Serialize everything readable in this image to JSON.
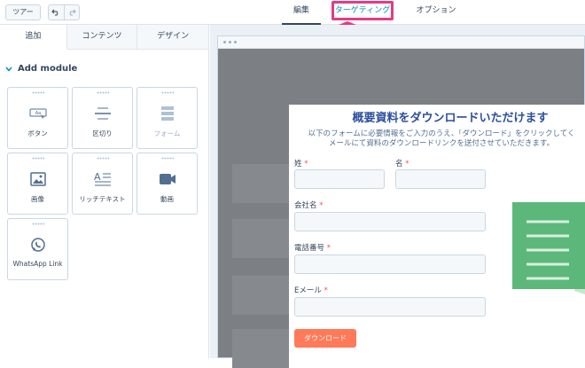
{
  "topbar": {
    "tour_label": "ツアー",
    "tabs": [
      {
        "label": "編集",
        "active": true
      },
      {
        "label": "ターゲティング",
        "highlighted": true
      },
      {
        "label": "オプション"
      }
    ],
    "highlight_color": "#e63a83"
  },
  "sidebar": {
    "tabs": [
      {
        "label": "追加",
        "active": true
      },
      {
        "label": "コンテンツ"
      },
      {
        "label": "デザイン"
      }
    ],
    "section_title": "Add module",
    "modules": [
      {
        "label": "ボタン",
        "icon": "button-icon"
      },
      {
        "label": "区切り",
        "icon": "divider-icon"
      },
      {
        "label": "フォーム",
        "icon": "form-icon",
        "disabled": true
      },
      {
        "label": "画像",
        "icon": "image-icon"
      },
      {
        "label": "リッチテキスト",
        "icon": "rich-text-icon"
      },
      {
        "label": "動画",
        "icon": "video-icon"
      },
      {
        "label": "WhatsApp Link",
        "icon": "whatsapp-icon"
      }
    ]
  },
  "popup": {
    "title": "概要資料をダウンロードいただけます",
    "description": "以下のフォームに必要情報をご入力のうえ、「ダウンロード」をクリックしてく\nメールにて資料のダウンロードリンクを送付させていただきます。",
    "fields": {
      "last_name": "姓",
      "first_name": "名",
      "company": "会社名",
      "phone": "電話番号",
      "email": "Eメール"
    },
    "required_mark": "*",
    "submit_label": "ダウンロード",
    "accent_color": "#ff7a59",
    "title_color": "#2c4f9e"
  }
}
